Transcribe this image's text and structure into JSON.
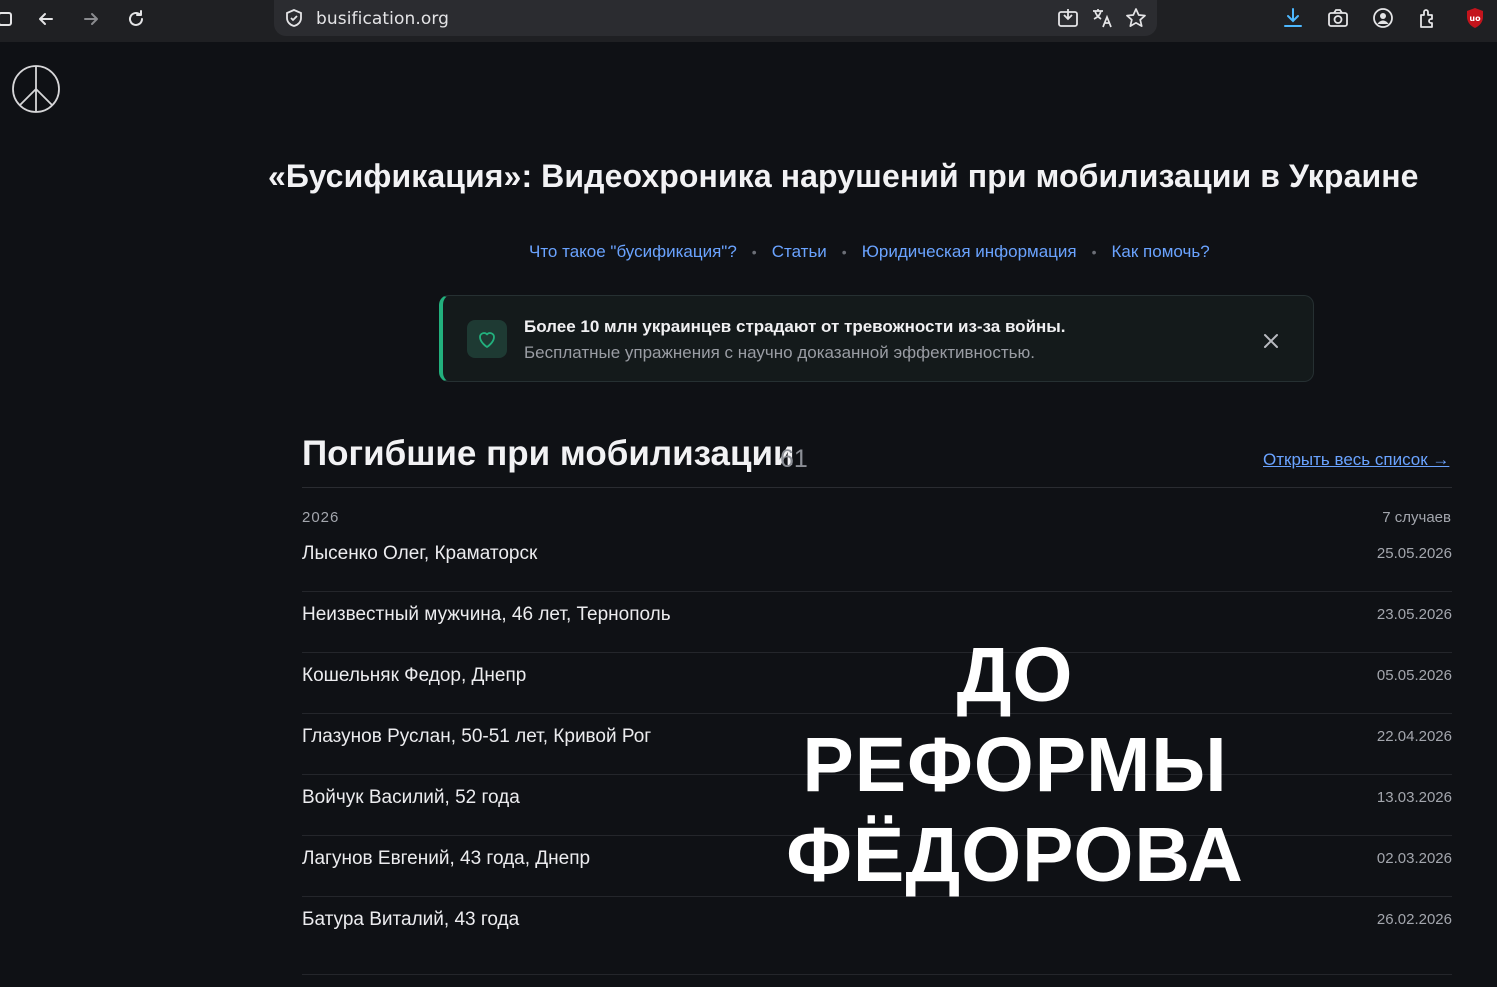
{
  "browser": {
    "url": "busification.org"
  },
  "page": {
    "title": "«Бусификация»: Видеохроника нарушений при мобилизации в Украине",
    "nav": [
      "Что такое \"бусификация\"?",
      "Статьи",
      "Юридическая информация",
      "Как помочь?"
    ]
  },
  "banner": {
    "title": "Более 10 млн украинцев страдают от тревожности из-за войны.",
    "subtitle": "Бесплатные упражнения с научно доказанной эффективностью.",
    "accent_color": "#22b07d"
  },
  "section": {
    "title": "Погибшие при мобилизации",
    "count": "61",
    "open_link": "Открыть весь список →",
    "year": "2026",
    "cases": "7 случаев",
    "items": [
      {
        "name": "Лысенко Олег, Краматорск",
        "date": "25.05.2026"
      },
      {
        "name": "Неизвестный мужчина, 46 лет, Тернополь",
        "date": "23.05.2026"
      },
      {
        "name": "Кошельняк Федор, Днепр",
        "date": "05.05.2026"
      },
      {
        "name": "Глазунов Руслан, 50-51 лет, Кривой Рог",
        "date": "22.04.2026"
      },
      {
        "name": "Войчук Василий, 52 года",
        "date": "13.03.2026"
      },
      {
        "name": "Лагунов Евгений, 43 года, Днепр",
        "date": "02.03.2026"
      },
      {
        "name": "Батура Виталий, 43 года",
        "date": "26.02.2026"
      }
    ]
  },
  "overlay": {
    "line1": "ДО",
    "line2": "РЕФОРМЫ",
    "line3": "ФЁДОРОВА"
  },
  "link_color": "#6aa3ff"
}
